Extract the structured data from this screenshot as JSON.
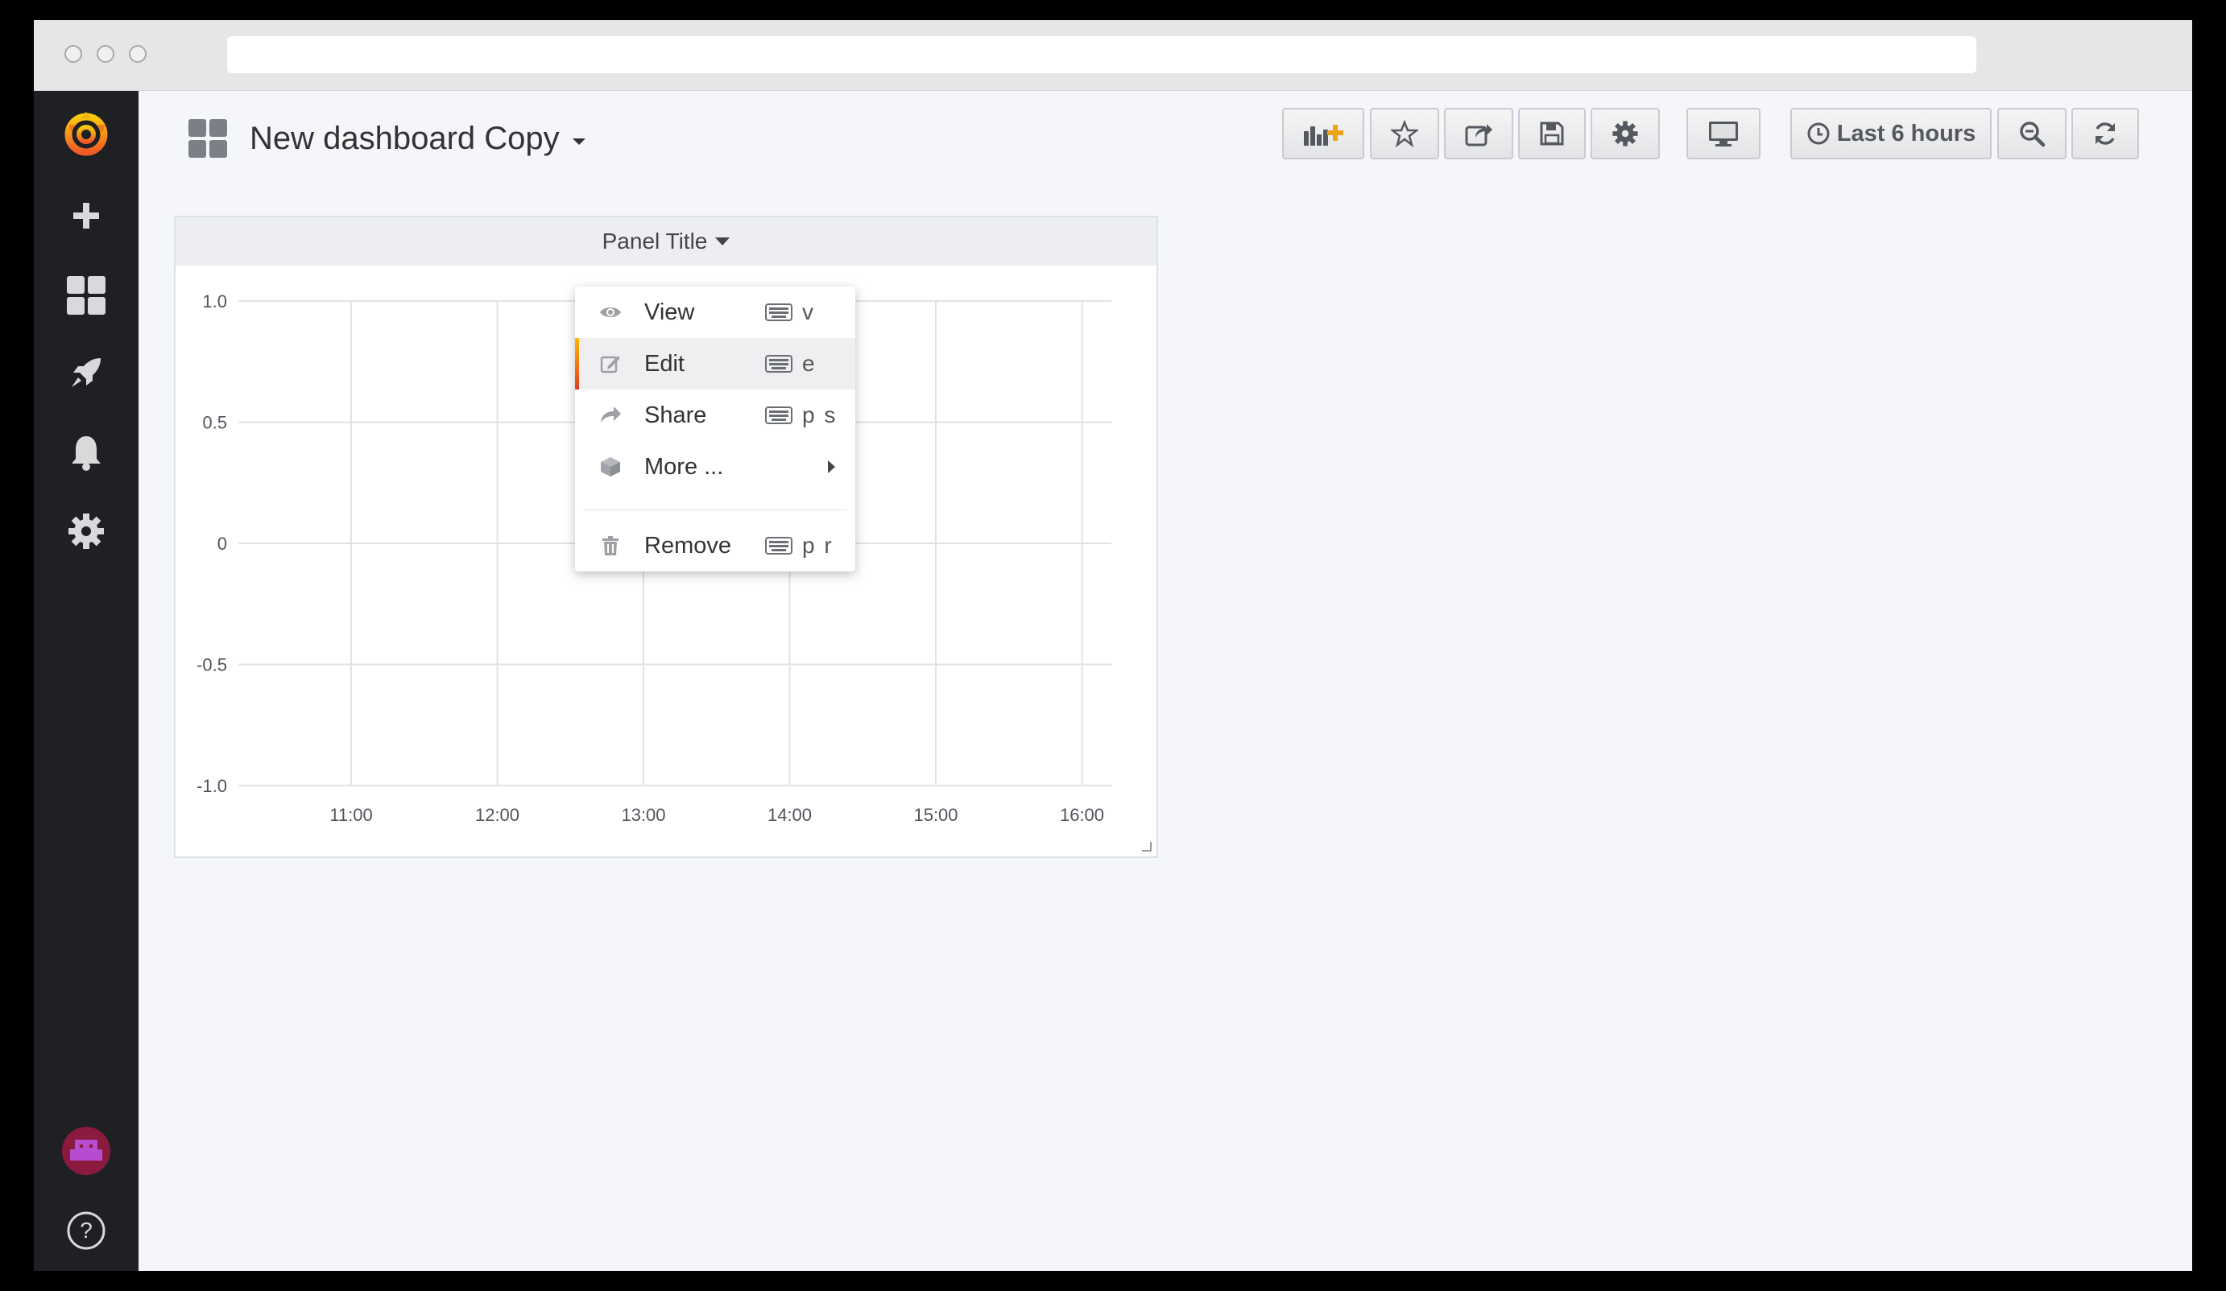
{
  "app": {
    "dashboard_title": "New dashboard Copy",
    "accent_color": "#f05a28"
  },
  "sidemenu": {
    "items": [
      {
        "name": "grafana-logo-icon"
      },
      {
        "name": "create-icon"
      },
      {
        "name": "dashboards-icon"
      },
      {
        "name": "explore-rocket-icon"
      },
      {
        "name": "alerting-bell-icon"
      },
      {
        "name": "configuration-gear-icon"
      },
      {
        "name": "user-avatar"
      },
      {
        "name": "help-icon"
      }
    ]
  },
  "toolbar": {
    "add_panel_icon": "bar-chart-plus-icon",
    "star_icon": "star-icon",
    "share_icon": "share-icon",
    "save_icon": "save-icon",
    "settings_icon": "gear-icon",
    "tv_mode_icon": "monitor-icon",
    "time_range_label": "Last 6 hours",
    "zoom_out_icon": "zoom-out-icon",
    "refresh_icon": "refresh-icon"
  },
  "panel": {
    "title": "Panel Title"
  },
  "menu": {
    "items": [
      {
        "label": "View",
        "shortcut": "v",
        "icon": "eye-icon"
      },
      {
        "label": "Edit",
        "shortcut": "e",
        "icon": "edit-icon",
        "active": true
      },
      {
        "label": "Share",
        "shortcut": "p s",
        "icon": "share-icon"
      },
      {
        "label": "More ...",
        "shortcut": "",
        "icon": "cube-icon",
        "submenu": true
      },
      {
        "label": "Remove",
        "shortcut": "p r",
        "icon": "trash-icon"
      }
    ]
  },
  "chart_data": {
    "type": "line",
    "title": "",
    "x": [
      "11:00",
      "12:00",
      "13:00",
      "14:00",
      "15:00",
      "16:00"
    ],
    "series": [],
    "yticks": [
      "1.0",
      "0.5",
      "0",
      "-0.5",
      "-1.0"
    ],
    "ylim": [
      -1.0,
      1.0
    ],
    "grid": true
  }
}
